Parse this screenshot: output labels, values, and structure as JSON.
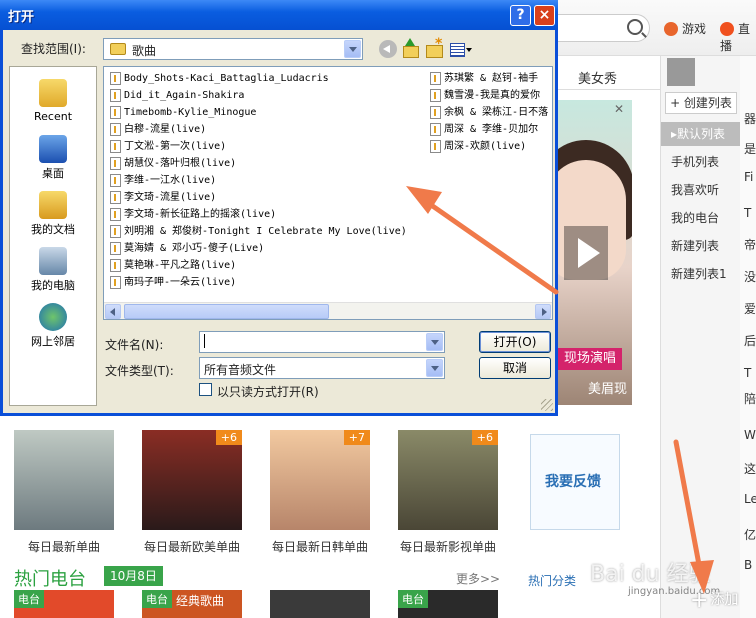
{
  "dialog": {
    "title": "打开",
    "help": "?",
    "close": "×",
    "lookin_label": "查找范围(I):",
    "lookin_value": "歌曲",
    "places": [
      {
        "label": "Recent",
        "icon": "recent-folder-icon"
      },
      {
        "label": "桌面",
        "icon": "desktop-icon"
      },
      {
        "label": "我的文档",
        "icon": "my-documents-icon"
      },
      {
        "label": "我的电脑",
        "icon": "my-computer-icon"
      },
      {
        "label": "网上邻居",
        "icon": "network-places-icon"
      }
    ],
    "files_col1": [
      "Body_Shots-Kaci_Battaglia_Ludacris",
      "Did_it_Again-Shakira",
      "Timebomb-Kylie_Minogue",
      "白穆-流星(live)",
      "丁文淞-第一次(live)",
      "胡慧仪-落叶归根(live)",
      "李维-一江水(live)",
      "李文琦-流星(live)",
      "李文琦-新长征路上的摇滚(live)",
      "刘明湘 & 郑俊树-Tonight I Celebrate My Love(live)",
      "莫海婧 & 邓小巧-傻子(Live)",
      "莫艳琳-平凡之路(live)",
      "南玛子呷-一朵云(live)"
    ],
    "files_col2": [
      "苏琪繁 & 赵钶-袖手",
      "魏雪漫-我是真的爱你",
      "余枫 & 梁栋江-日不落",
      "周深 & 李维-贝加尔",
      "周深-欢颜(live)"
    ],
    "filename_label": "文件名(N):",
    "filename_value": "",
    "filetype_label": "文件类型(T):",
    "filetype_value": "所有音频文件",
    "open_label": "打开(O)",
    "cancel_label": "取消",
    "readonly_label": "以只读方式打开(R)"
  },
  "app": {
    "game_label": "游戏",
    "live_label": "直播",
    "tab_meinv": "美女秀",
    "promo_badge": "现场演唱",
    "promo_caption": "美眉现",
    "create_list": "+ 创建列表",
    "sidebar_items": [
      "▸默认列表",
      "手机列表",
      "我喜欢听",
      "我的电台",
      "新建列表",
      "新建列表1"
    ],
    "albums": [
      {
        "label": "每日最新单曲",
        "badge": ""
      },
      {
        "label": "每日最新欧美单曲",
        "badge": "+6"
      },
      {
        "label": "每日最新日韩单曲",
        "badge": "+7"
      },
      {
        "label": "每日最新影视单曲",
        "badge": "+6"
      }
    ],
    "feedback": "我要反馈",
    "hot_radio": "热门电台",
    "radio_date": "10月8日",
    "more": "更多>>",
    "hot_category": "热门分类",
    "radio_tag": "电台",
    "radio_text": "经典歌曲",
    "add_label": "添加",
    "watermark": "Bai du 经验",
    "watermark_sub": "jingyan.baidu.com",
    "right_col": [
      "器",
      "是",
      "Fi",
      "T",
      "帝",
      "没",
      "爱",
      "后",
      "T",
      "陪",
      "W",
      "这",
      "Le",
      "亿",
      "B"
    ]
  },
  "colors": {
    "annotation_arrow": "#f07a4a",
    "xp_blue": "#0a5de0"
  }
}
